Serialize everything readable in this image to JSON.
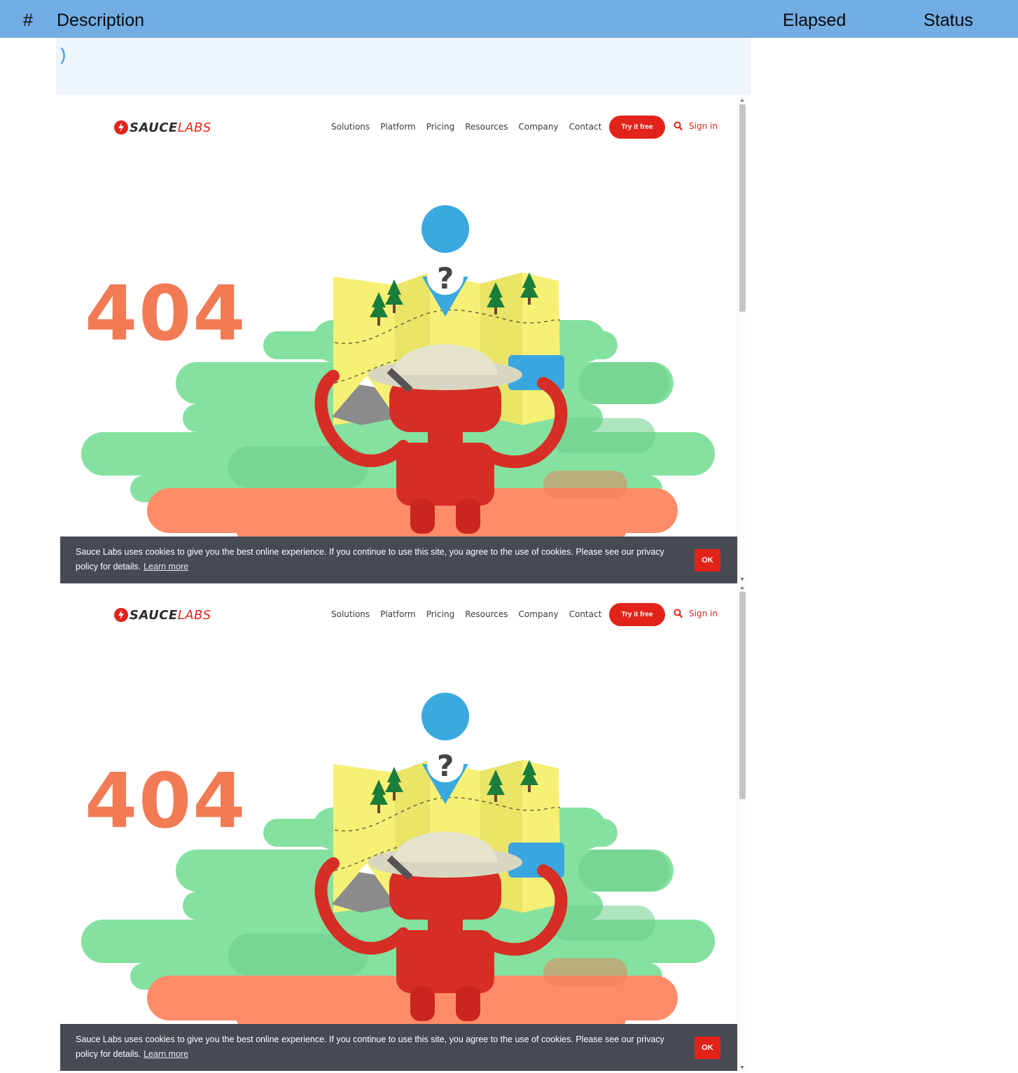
{
  "table": {
    "headers": {
      "num": "#",
      "description": "Description",
      "elapsed": "Elapsed",
      "status": "Status"
    },
    "row": {
      "description_text": ")"
    }
  },
  "screenshot": {
    "logo": {
      "part1": "SAUCE",
      "part2": "LABS"
    },
    "nav": {
      "links": [
        "Solutions",
        "Platform",
        "Pricing",
        "Resources",
        "Company",
        "Contact"
      ],
      "try_free": "Try it free",
      "sign_in": "Sign in"
    },
    "error_code": "404",
    "cookie": {
      "message": "Sauce Labs uses cookies to give you the best online experience. If you continue to use this site, you agree to the use of cookies. Please see our privacy policy for details.",
      "learn_more": "Learn more",
      "ok": "OK"
    }
  },
  "colors": {
    "header_bg": "#72ade3",
    "desc_bg": "#eff6fe",
    "brand_red": "#e2231a",
    "green": "#84e19f",
    "orange": "#ff8c69",
    "yellow": "#f6f175",
    "cookie_bg": "#464b53"
  }
}
